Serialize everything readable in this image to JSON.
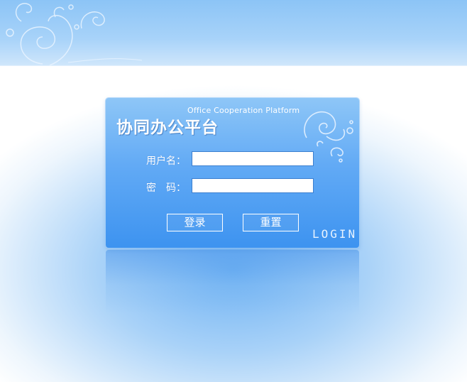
{
  "panel": {
    "title": "协同办公平台",
    "subtitle": "Office Cooperation Platform",
    "corner_tag": "LOGIN"
  },
  "form": {
    "username_label": "用户名：",
    "password_label": "密　码：",
    "username_value": "",
    "password_value": ""
  },
  "buttons": {
    "login_label": "登录",
    "reset_label": "重置"
  },
  "colors": {
    "panel_top": "#8ec6f7",
    "panel_bottom": "#3d93f0",
    "header_band": "#8cc4f6"
  },
  "icons": [
    "swirl-decoration-icon"
  ]
}
